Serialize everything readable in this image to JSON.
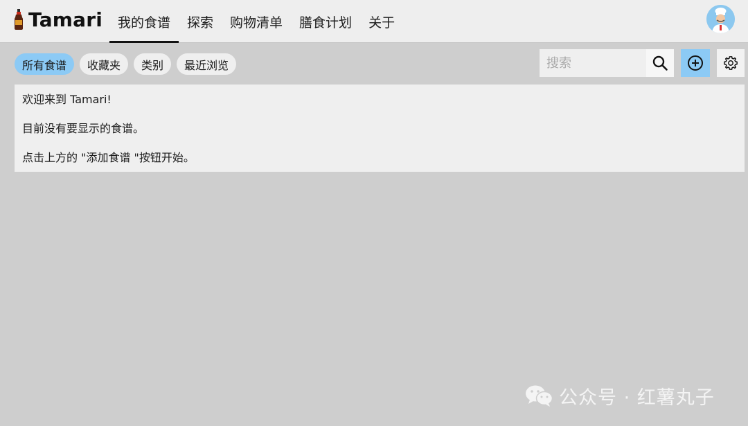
{
  "app": {
    "name": "Tamari"
  },
  "nav": {
    "items": [
      {
        "label": "我的食谱",
        "active": true
      },
      {
        "label": "探索",
        "active": false
      },
      {
        "label": "购物清单",
        "active": false
      },
      {
        "label": "膳食计划",
        "active": false
      },
      {
        "label": "关于",
        "active": false
      }
    ]
  },
  "filters": {
    "chips": [
      {
        "label": "所有食谱",
        "active": true
      },
      {
        "label": "收藏夹",
        "active": false
      },
      {
        "label": "类别",
        "active": false
      },
      {
        "label": "最近浏览",
        "active": false
      }
    ]
  },
  "search": {
    "placeholder": "搜索",
    "value": ""
  },
  "icons": {
    "logo": "soy-sauce-bottle-icon",
    "avatar": "chef-avatar",
    "search": "search-icon",
    "add": "plus-circle-icon",
    "settings": "gear-icon",
    "watermark": "wechat-icon"
  },
  "colors": {
    "accent": "#8ccaf5",
    "background": "#cecece",
    "panel": "#efefef"
  },
  "message": {
    "welcome": "欢迎来到 Tamari!",
    "empty": "目前没有要显示的食谱。",
    "hint": "点击上方的 \"添加食谱 \"按钮开始。"
  },
  "watermark": {
    "text": "公众号 · 红薯丸子"
  }
}
